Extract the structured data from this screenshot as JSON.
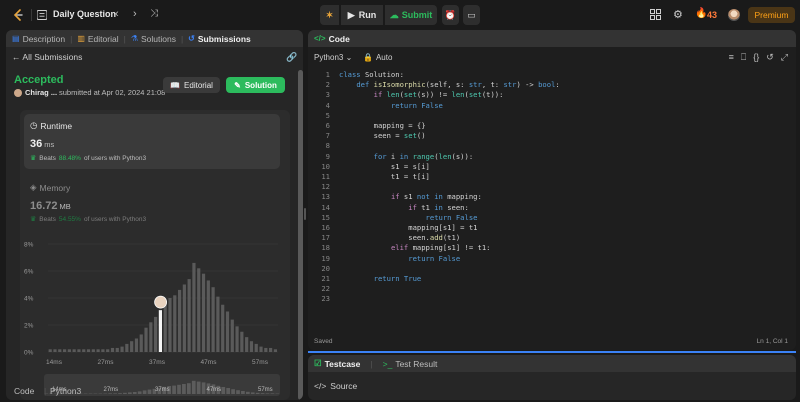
{
  "topbar": {
    "title": "Daily Question",
    "run_label": "Run",
    "submit_label": "Submit",
    "streak_count": "43",
    "premium_label": "Premium"
  },
  "left_tabs": [
    {
      "label": "Description",
      "icon": "description-icon"
    },
    {
      "label": "Editorial",
      "icon": "editorial-icon"
    },
    {
      "label": "Solutions",
      "icon": "solutions-icon"
    },
    {
      "label": "Submissions",
      "icon": "submissions-icon"
    }
  ],
  "submission": {
    "back_label": "All Submissions",
    "status": "Accepted",
    "user": "Chirag ...",
    "submitted_at": "submitted at Apr 02, 2024 21:08",
    "editorial_button": "Editorial",
    "solution_button": "Solution",
    "runtime_label": "Runtime",
    "runtime_value": "36",
    "runtime_unit": "ms",
    "runtime_beats_prefix": "Beats",
    "runtime_beats_pct": "88.48%",
    "runtime_beats_suffix": "of users with Python3",
    "memory_label": "Memory",
    "memory_value": "16.72",
    "memory_unit": "MB",
    "memory_beats_prefix": "Beats",
    "memory_beats_pct": "54.55%",
    "memory_beats_suffix": "of users with Python3",
    "footer_code_label": "Code",
    "footer_lang": "Python3"
  },
  "chart_data": {
    "type": "bar",
    "yticks": [
      "8%",
      "6%",
      "4%",
      "2%",
      "0%"
    ],
    "ylim": [
      0,
      8
    ],
    "xticks": [
      "14ms",
      "27ms",
      "37ms",
      "47ms",
      "57ms"
    ],
    "values": [
      0.2,
      0.2,
      0.2,
      0.2,
      0.2,
      0.2,
      0.2,
      0.2,
      0.2,
      0.2,
      0.2,
      0.2,
      0.2,
      0.3,
      0.3,
      0.4,
      0.6,
      0.8,
      1.0,
      1.3,
      1.8,
      2.2,
      2.6,
      3.1,
      3.6,
      4.0,
      4.2,
      4.6,
      5.0,
      5.4,
      6.6,
      6.2,
      5.8,
      5.3,
      4.8,
      4.1,
      3.5,
      3.0,
      2.4,
      1.9,
      1.5,
      1.1,
      0.8,
      0.6,
      0.4,
      0.3,
      0.3,
      0.2
    ],
    "highlight_index": 23
  },
  "editor": {
    "header": "Code",
    "language": "Python3",
    "mode": "Auto",
    "lines": [
      "class Solution:",
      "    def isIsomorphic(self, s: str, t: str) -> bool:",
      "        if len(set(s)) != len(set(t)):",
      "            return False",
      "",
      "        mapping = {}",
      "        seen = set()",
      "",
      "        for i in range(len(s)):",
      "            s1 = s[i]",
      "            t1 = t[i]",
      "",
      "            if s1 not in mapping:",
      "                if t1 in seen:",
      "                    return False",
      "                mapping[s1] = t1",
      "                seen.add(t1)",
      "            elif mapping[s1] != t1:",
      "                return False",
      "",
      "        return True",
      "",
      ""
    ],
    "status": "Saved",
    "cursor": "Ln 1, Col 1"
  },
  "testpanel": {
    "tab_testcase": "Testcase",
    "tab_result": "Test Result",
    "source_label": "Source"
  },
  "colors": {
    "accent_green": "#2cbb5d",
    "premium_orange": "#ffa116",
    "focus_blue": "#3b82f6"
  }
}
